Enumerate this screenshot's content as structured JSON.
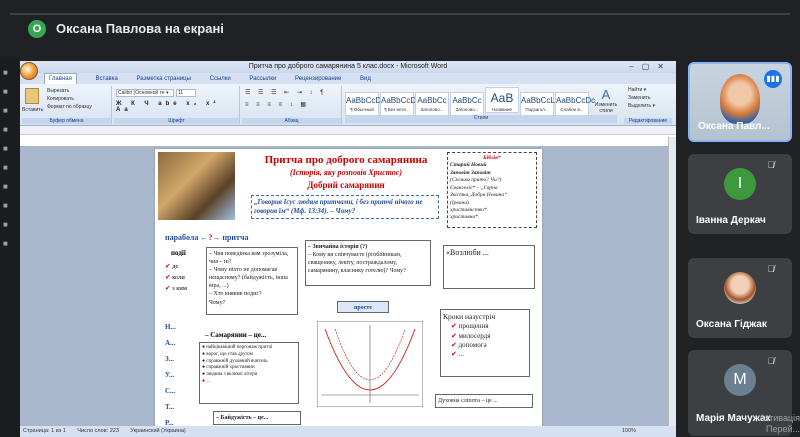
{
  "banner": {
    "initial": "О",
    "text": "Оксана Павлова на екрані"
  },
  "word": {
    "window_title": "Притча про доброго самарянина 5 клас.docx - Microsoft Word",
    "tabs": [
      "Главная",
      "Вставка",
      "Разметка страницы",
      "Ссылки",
      "Рассылки",
      "Рецензирование",
      "Вид"
    ],
    "groups": {
      "clipboard": "Буфер обмена",
      "font": "Шрифт",
      "paragraph": "Абзац",
      "styles": "Стили",
      "editing": "Редактирование"
    },
    "clipboard": {
      "paste": "Вставить",
      "cut": "Вырезать",
      "copy": "Копировать",
      "format": "Формат по образцу"
    },
    "font": {
      "name": "Calibri (Основной те ▾",
      "size": "11"
    },
    "styles": [
      {
        "sample": "AaBbCcDc",
        "name": "¶ Обычный"
      },
      {
        "sample": "AaBbCcDc",
        "name": "¶ Без инте..."
      },
      {
        "sample": "AaBbCc",
        "name": "Заголово..."
      },
      {
        "sample": "AaBbCc",
        "name": "Заголово..."
      },
      {
        "sample": "AaB",
        "name": "Название"
      },
      {
        "sample": "AaBbCcL",
        "name": "Подзагол..."
      },
      {
        "sample": "AaBbCcDc",
        "name": "Слабое в..."
      }
    ],
    "change_styles": "Изменить стили",
    "editing": [
      "Найти ▾",
      "Заменить",
      "Выделить ▾"
    ],
    "status": {
      "page": "Страница: 1 из 1",
      "words": "Число слов: 223",
      "lang": "Украинский (Украина)",
      "zoom": "100%"
    }
  },
  "doc": {
    "title1": "Притча про доброго самарянина",
    "title2": "(Історія, яку розповів Христос)",
    "title3": "Добрий самарянин",
    "quote": "„Говорив Ісус людям притчами, і без притчі нічого не говорив їм“ (Мф. 13:34). – Чому?",
    "bible": [
      "Біблія*",
      "Старий   Новий",
      "Заповіт   Заповіт",
      "(Скільки притч? Чи?)",
      "Євангеліє* – „Гарна",
      "Звістка, Добра Новина“",
      "(Ірвана)",
      "християнство*",
      "християни*"
    ],
    "parabola": "парабола",
    "question_mark": "?",
    "pritcha": "притча",
    "podii": "події",
    "de_items": [
      "де",
      "коли",
      "з ким"
    ],
    "qbox": [
      "– Чия поведінка вам зрозуміла, чия – ні?",
      "– Чому ніхто не допомагав нещасному? (байдужість, інша віра, ...)",
      "– Хто виявив подиг?",
      "Чому?"
    ],
    "story_title": "– Звичайна історія (?)",
    "story_text": "– Кому ви співчуваєте (розбійникам, священику, левіту, постраждалому, самарянину, власнику готелю)? Чому?",
    "vozliubi": "«Возлюби ...",
    "letters": [
      "Н...",
      "А...",
      "З...",
      "У...",
      "С...",
      "Т...",
      "Р..."
    ],
    "samarian": "– Самарянин – це...",
    "samarian_list": [
      "найцікавіший персонаж притчі",
      "ворог, що став другом",
      "справжній духовний вчитель",
      "справжній християнин",
      "людина з великої літери",
      "..."
    ],
    "proste": "просте",
    "steps_title": "Кроки назустріч",
    "steps": [
      "прощення",
      "милосердя",
      "допомога",
      "..."
    ],
    "bottom1": "– Байдужість – це...",
    "bottom2": "Духовна сліпота – це ..."
  },
  "participants": [
    {
      "name": "Оксана Павл...",
      "kind": "photo"
    },
    {
      "name": "Іванна Деркач",
      "initial": "І",
      "color": "#3c9a3c"
    },
    {
      "name": "Оксана Гіджак",
      "kind": "photo"
    },
    {
      "name": "Марія Мачужак",
      "initial": "М",
      "color": "#6b7f93"
    }
  ],
  "watermark": [
    "Активація",
    "Перей..."
  ]
}
